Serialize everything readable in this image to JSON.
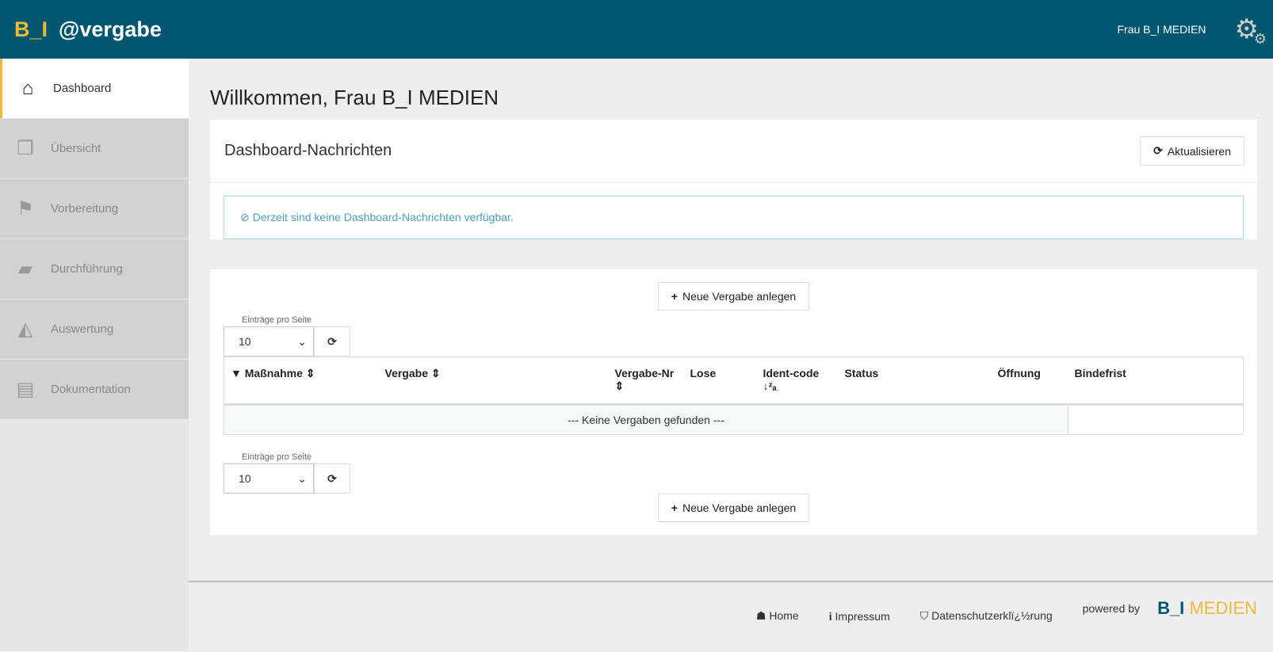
{
  "header": {
    "logo_bi": "B_I",
    "logo_ev": "@vergabe",
    "user": "Frau B_I MEDIEN"
  },
  "sidebar": {
    "items": [
      {
        "label": "Dashboard",
        "icon": "⌂"
      },
      {
        "label": "Übersicht",
        "icon": "❒"
      },
      {
        "label": "Vorbereitung",
        "icon": "⚑"
      },
      {
        "label": "Durchführung",
        "icon": "▰"
      },
      {
        "label": "Auswertung",
        "icon": "◭"
      },
      {
        "label": "Dokumentation",
        "icon": "▤"
      }
    ]
  },
  "main": {
    "title": "Willkommen, Frau B_I MEDIEN",
    "news": {
      "title": "Dashboard-Nachrichten",
      "refresh": "Aktualisieren",
      "empty": "Derzeit sind keine Dashboard-Nachrichten verfügbar."
    },
    "table": {
      "new_button": "Neue Vergabe anlegen",
      "per_page_label": "Einträge pro Seite",
      "per_page": "10",
      "columns": [
        "Maßnahme ⇕",
        "Vergabe ⇕",
        "Vergabe-Nr ⇕",
        "Lose",
        "Ident-code ↓ᶻₐ",
        "Status",
        "Öffnung",
        "Bindefrist"
      ],
      "empty": "--- Keine Vergaben gefunden ---"
    }
  },
  "footer": {
    "home": "Home",
    "impressum": "Impressum",
    "privacy": "Datenschutzerklï¿½rung",
    "powered": "powered by",
    "brand_bi": "B_I",
    "brand_medien": "MEDIEN"
  }
}
